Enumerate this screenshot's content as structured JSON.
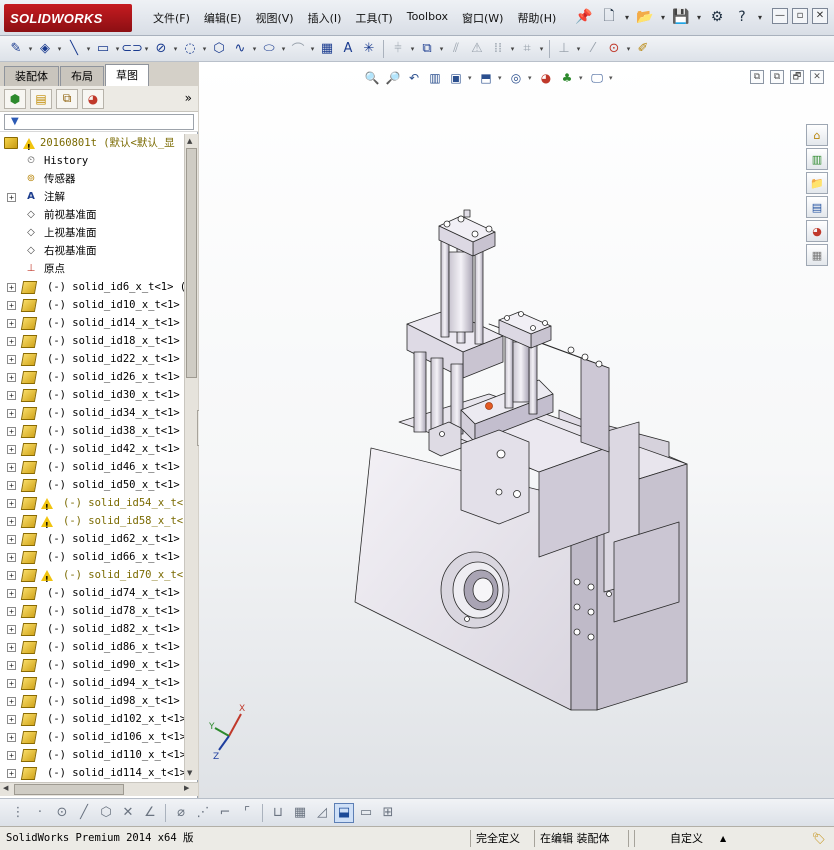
{
  "app": {
    "logo_text": "SOLIDWORKS",
    "menu": [
      "文件(F)",
      "编辑(E)",
      "视图(V)",
      "插入(I)",
      "工具(T)",
      "Toolbox",
      "窗口(W)",
      "帮助(H)"
    ]
  },
  "quick_access": {
    "icons": [
      "pin-icon",
      "new-document-icon",
      "open-icon",
      "save-icon",
      "options-icon",
      "help-icon"
    ],
    "window_controls": [
      "—",
      "▫",
      "✕"
    ]
  },
  "sketch_toolbar": {
    "icons": [
      "sketch-icon",
      "smart-dimension-icon",
      "line-icon",
      "rectangle-icon",
      "slot-icon",
      "circle-icon",
      "arc-icon",
      "polygon-icon",
      "spline-icon",
      "ellipse-icon",
      "fillet-icon",
      "plane-icon",
      "text-icon",
      "point-icon",
      "trim-icon",
      "offset-icon",
      "mirror-icon",
      "relation-icon",
      "linear-pattern-icon",
      "move-icon",
      "repair-icon",
      "quick-snap-icon",
      "display-relations-icon",
      "rapid-sketch-icon"
    ]
  },
  "left_panel": {
    "tabs": [
      "装配体",
      "布局",
      "草图"
    ],
    "active_tab": 2,
    "feature_manager_icons": [
      "feature-manager-icon",
      "property-manager-icon",
      "configuration-manager-icon",
      "display-manager-icon"
    ],
    "more_label": "»",
    "filter_glyph": "▼",
    "tree": {
      "root": "20160801t  (默认<默认_显",
      "features": [
        "History",
        "传感器",
        "注解",
        "前视基准面",
        "上视基准面",
        "右视基准面",
        "原点"
      ],
      "components": [
        {
          "label": "(-) solid_id6_x_t<1> (默",
          "warning": false
        },
        {
          "label": "(-) solid_id10_x_t<1> (",
          "warning": false
        },
        {
          "label": "(-) solid_id14_x_t<1> (",
          "warning": false
        },
        {
          "label": "(-) solid_id18_x_t<1> (",
          "warning": false
        },
        {
          "label": "(-) solid_id22_x_t<1> (",
          "warning": false
        },
        {
          "label": "(-) solid_id26_x_t<1> (",
          "warning": false
        },
        {
          "label": "(-) solid_id30_x_t<1> (",
          "warning": false
        },
        {
          "label": "(-) solid_id34_x_t<1> (",
          "warning": false
        },
        {
          "label": "(-) solid_id38_x_t<1> (",
          "warning": false
        },
        {
          "label": "(-) solid_id42_x_t<1> (",
          "warning": false
        },
        {
          "label": "(-) solid_id46_x_t<1> (",
          "warning": false
        },
        {
          "label": "(-) solid_id50_x_t<1> (",
          "warning": false
        },
        {
          "label": "(-) solid_id54_x_t<1",
          "warning": true
        },
        {
          "label": "(-) solid_id58_x_t<1",
          "warning": true
        },
        {
          "label": "(-) solid_id62_x_t<1> (",
          "warning": false
        },
        {
          "label": "(-) solid_id66_x_t<1> (",
          "warning": false
        },
        {
          "label": "(-) solid_id70_x_t<1",
          "warning": true
        },
        {
          "label": "(-) solid_id74_x_t<1> (",
          "warning": false
        },
        {
          "label": "(-) solid_id78_x_t<1> (",
          "warning": false
        },
        {
          "label": "(-) solid_id82_x_t<1> (",
          "warning": false
        },
        {
          "label": "(-) solid_id86_x_t<1> (",
          "warning": false
        },
        {
          "label": "(-) solid_id90_x_t<1> (",
          "warning": false
        },
        {
          "label": "(-) solid_id94_x_t<1> (",
          "warning": false
        },
        {
          "label": "(-) solid_id98_x_t<1> (",
          "warning": false
        },
        {
          "label": "(-) solid_id102_x_t<1>",
          "warning": false
        },
        {
          "label": "(-) solid_id106_x_t<1>",
          "warning": false
        },
        {
          "label": "(-) solid_id110_x_t<1>",
          "warning": false
        },
        {
          "label": "(-) solid_id114_x_t<1>",
          "warning": false
        }
      ]
    }
  },
  "viewport": {
    "heads_up_icons": [
      "zoom-to-fit-icon",
      "zoom-to-area-icon",
      "previous-view-icon",
      "section-view-icon",
      "dynamic-annotation-icon",
      "view-orientation-icon",
      "display-style-icon",
      "hide-show-icon",
      "edit-appearance-icon",
      "apply-scene-icon",
      "view-settings-icon"
    ],
    "window_controls": [
      "⧉",
      "⧉",
      "🗗",
      "✕"
    ],
    "task_pane_icons": [
      "home-icon",
      "design-library-icon",
      "file-explorer-icon",
      "view-palette-icon",
      "appearances-icon",
      "custom-properties-icon"
    ],
    "triad": {
      "x": "X",
      "y": "Y",
      "z": "Z"
    }
  },
  "view_toolbar": {
    "icons": [
      "point-icon",
      "circle-icon",
      "line-icon",
      "polygon-icon",
      "trim-icon",
      "extend-icon",
      "angle-icon",
      "split-icon",
      "convert-icon",
      "intersect-icon",
      "corner-icon",
      "dim-icon",
      "grid-icon",
      "angle2-icon",
      "3d-sketch-icon",
      "view-icon",
      "layout-icon"
    ],
    "active_index": 14
  },
  "status_bar": {
    "product": "SolidWorks Premium 2014 x64 版",
    "definition": "完全定义",
    "editing": "在编辑 装配体",
    "units": "自定义",
    "units_caret": "▲"
  },
  "colors": {
    "brand": "#c51b20",
    "viewport_bg_top": "#ffffff",
    "viewport_bg_bottom": "#dfe2e6",
    "warning": "#f1c40f",
    "tree_warning_text": "#7a6a00"
  }
}
